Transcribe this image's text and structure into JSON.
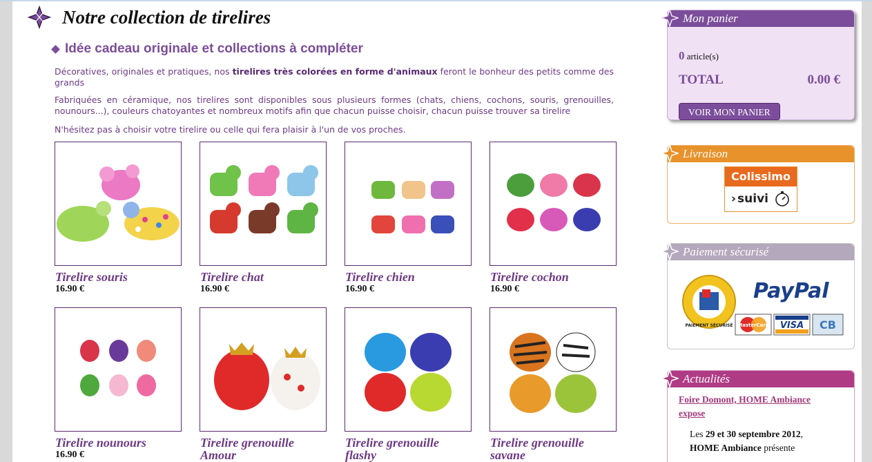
{
  "page": {
    "title": "Notre collection de tirelires",
    "section_title": "Idée cadeau originale et collections à compléter",
    "intro": {
      "p1_a": "Décoratives, originales et pratiques, nos ",
      "p1_b": "tirelires très colorées en forme d'animaux",
      "p1_c": " feront le bonheur des petits comme des grands",
      "p2": "Fabriquées en céramique, nos tirelires sont disponibles sous plusieurs formes (chats, chiens, cochons, souris, grenouilles, nounours...), couleurs chatoyantes et nombreux motifs afin que chacun puisse choisir, chacun puisse trouver sa tirelire",
      "p3": "N'hésitez pas à choisir votre tirelire ou celle qui fera plaisir à l'un de vos proches."
    }
  },
  "products": [
    {
      "name": "Tirelire souris",
      "price": "16.90 €"
    },
    {
      "name": "Tirelire chat",
      "price": "16.90 €"
    },
    {
      "name": "Tirelire chien",
      "price": "16.90 €"
    },
    {
      "name": "Tirelire cochon",
      "price": "16.90 €"
    },
    {
      "name": "Tirelire nounours",
      "price": "16.90 €"
    },
    {
      "name": "Tirelire grenouille Amour",
      "price": ""
    },
    {
      "name": "Tirelire grenouille flashy",
      "price": ""
    },
    {
      "name": "Tirelire grenouille savane",
      "price": ""
    }
  ],
  "sidebar": {
    "cart": {
      "title": "Mon panier",
      "count": "0",
      "count_label": "article(s)",
      "total_label": "TOTAL",
      "total_value": "0.00 €",
      "button": "VOIR MON PANIER"
    },
    "livraison": {
      "title": "Livraison",
      "logo_top": "Colissimo",
      "logo_bottom": "suivi"
    },
    "paiement": {
      "title": "Paiement sécurisé",
      "paypal": "PayPal",
      "mastercard": "MasterCard",
      "visa": "VISA",
      "cb": "CB",
      "seal_text": "PAIEMENT SÉCURISÉ"
    },
    "actualites": {
      "title": "Actualités",
      "link": "Foire Domont, HOME Ambiance expose",
      "text_a": "Les ",
      "text_b": "29 et 30 septembre 2012",
      "text_c": ",",
      "text_d": "HOME Ambiance",
      "text_e": " présente"
    }
  },
  "colors": {
    "brand_purple": "#7b4d9a",
    "livraison_orange": "#e8922b",
    "paiement_grey": "#b4a8bc",
    "actu_pink": "#b03b85"
  }
}
